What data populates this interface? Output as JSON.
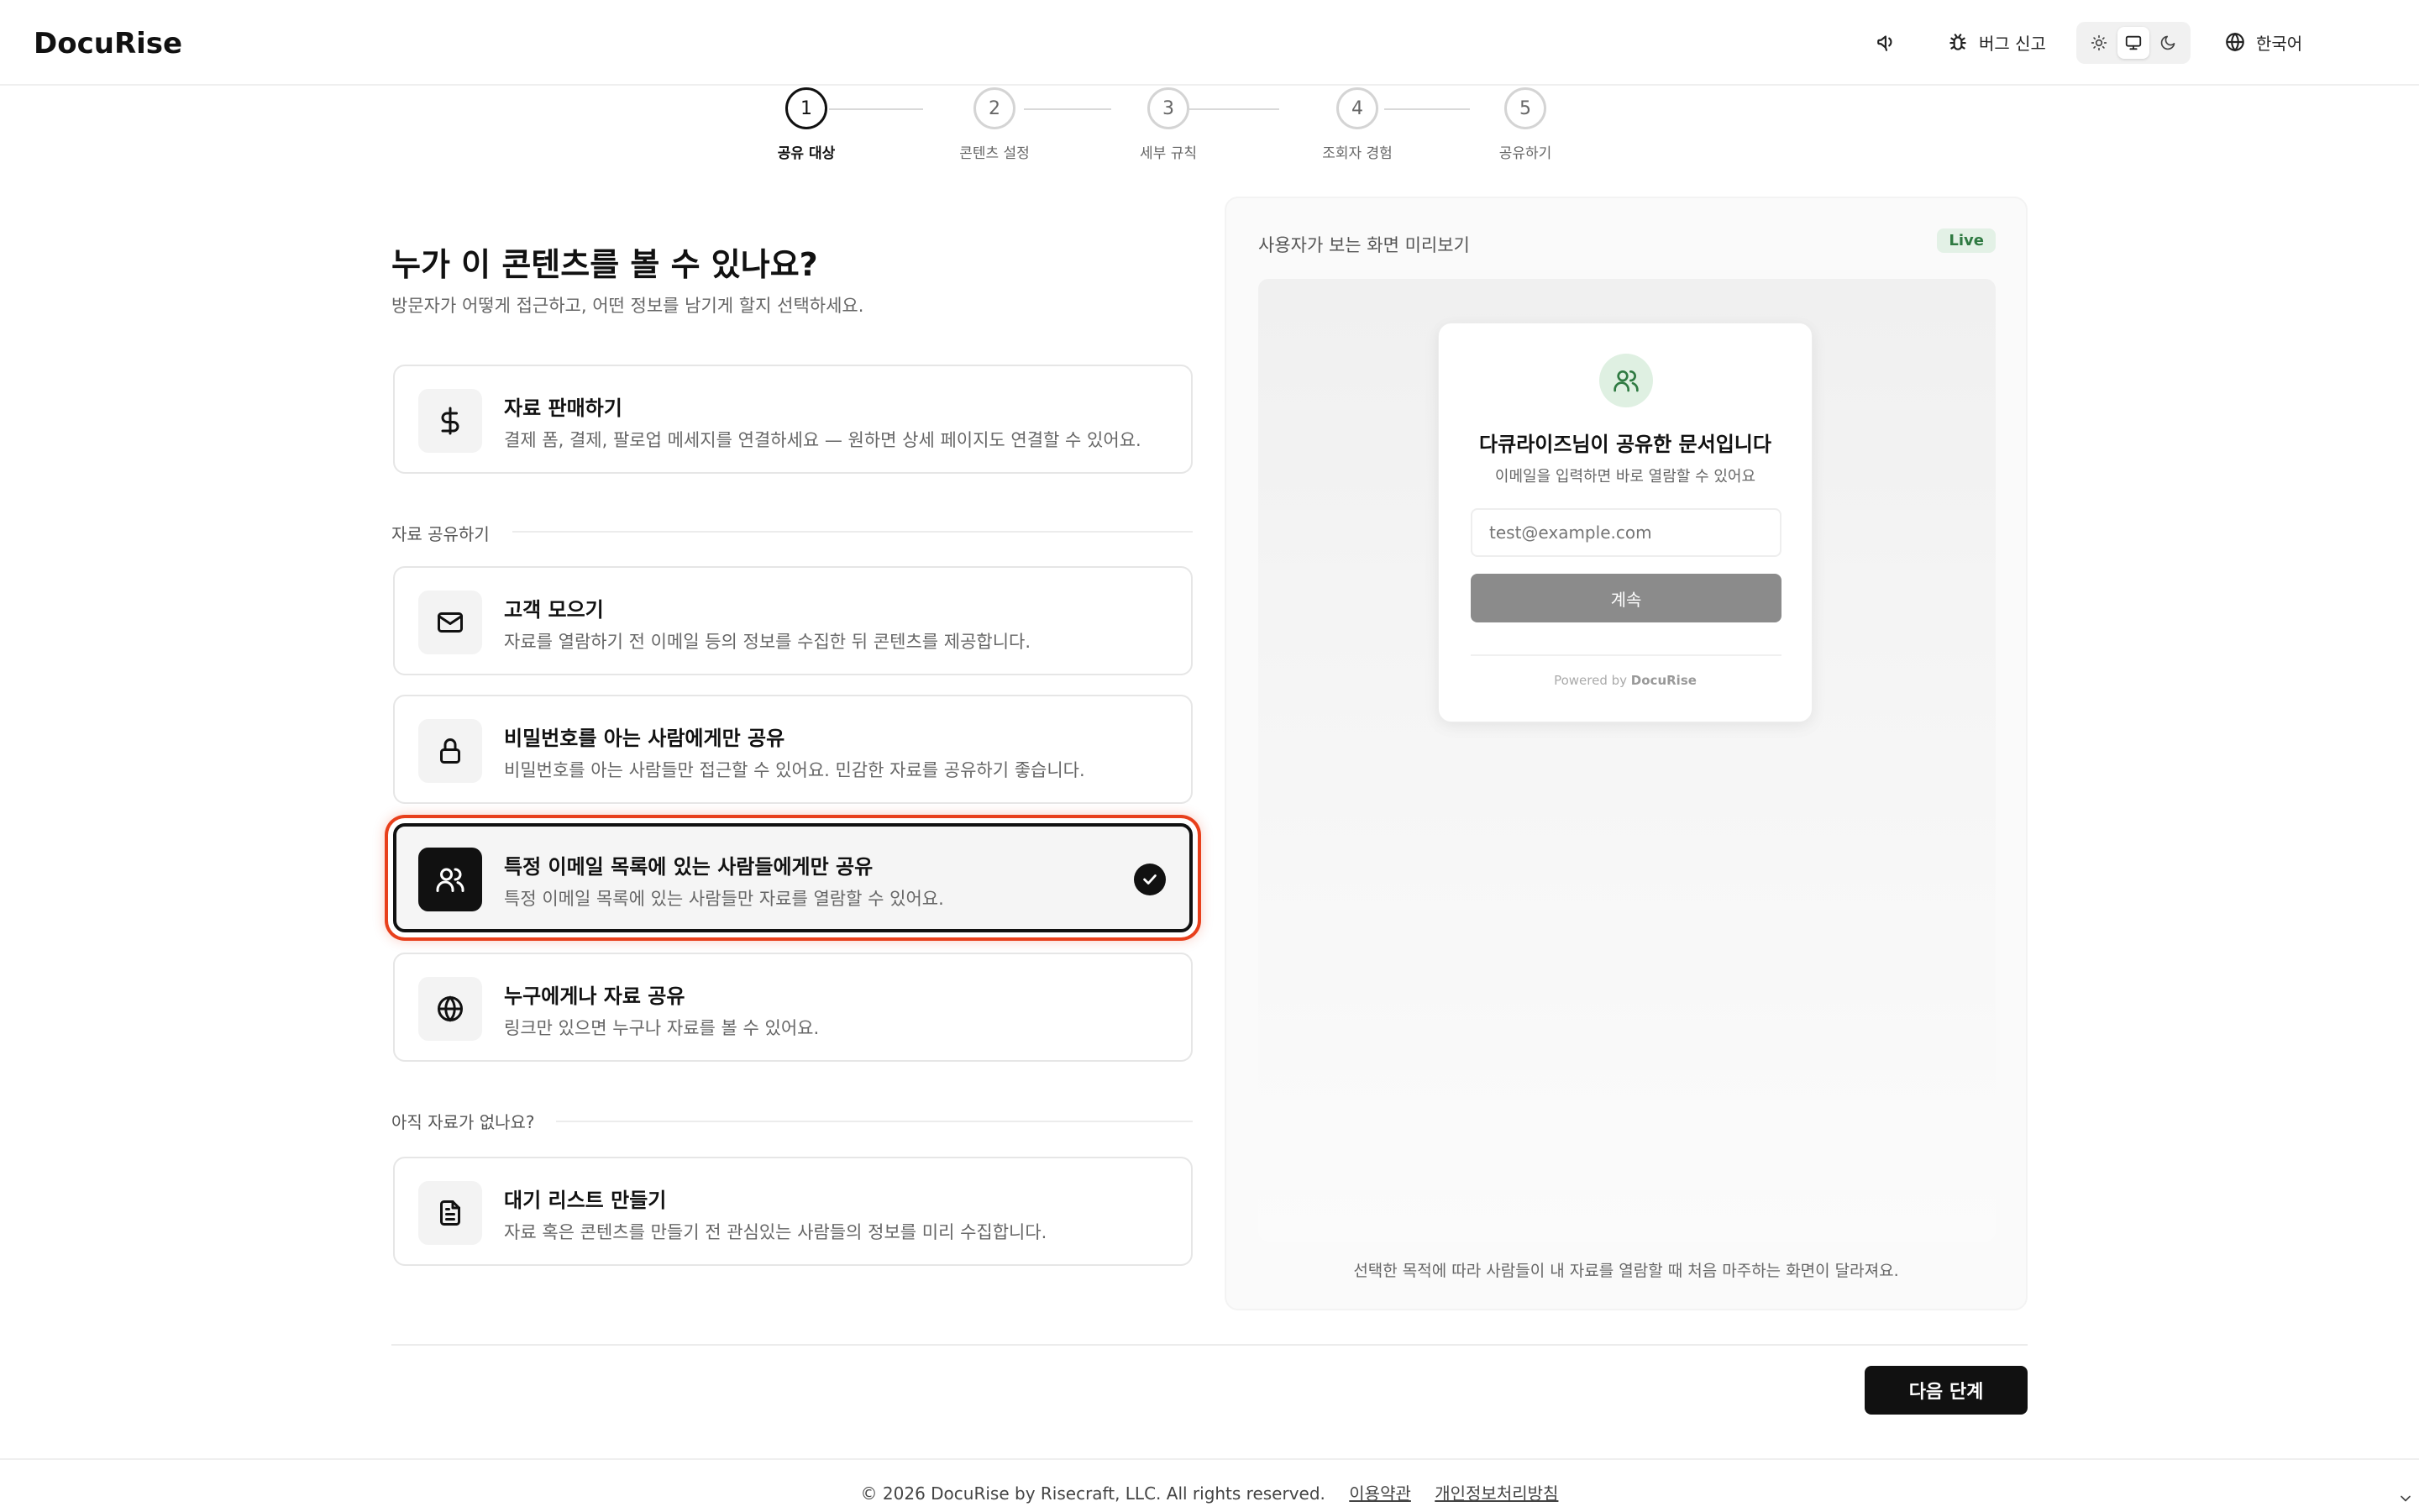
{
  "header": {
    "logo": "DocuRise",
    "bug_report": "버그 신고",
    "language": "한국어",
    "theme_options": [
      "sun-icon",
      "monitor-icon",
      "moon-icon"
    ],
    "theme_selected": "monitor-icon"
  },
  "stepper": {
    "current": 1,
    "steps": [
      {
        "num": "1",
        "label": "공유 대상"
      },
      {
        "num": "2",
        "label": "콘텐츠 설정"
      },
      {
        "num": "3",
        "label": "세부 규칙"
      },
      {
        "num": "4",
        "label": "조회자 경험"
      },
      {
        "num": "5",
        "label": "공유하기"
      }
    ]
  },
  "main": {
    "title": "누가 이 콘텐츠를 볼 수 있나요?",
    "subtitle": "방문자가 어떻게 접근하고, 어떤 정보를 남기게 할지 선택하세요.",
    "sell": {
      "icon": "dollar-icon",
      "title": "자료 판매하기",
      "desc": "결제 폼, 결제, 팔로업 메세지를 연결하세요 — 원하면 상세 페이지도 연결할 수 있어요."
    },
    "share_section_label": "자료 공유하기",
    "share_options": [
      {
        "icon": "mail-icon",
        "title": "고객 모으기",
        "desc": "자료를 열람하기 전 이메일 등의 정보를 수집한 뒤 콘텐츠를 제공합니다.",
        "selected": false
      },
      {
        "icon": "lock-icon",
        "title": "비밀번호를 아는 사람에게만 공유",
        "desc": "비밀번호를 아는 사람들만 접근할 수 있어요. 민감한 자료를 공유하기 좋습니다.",
        "selected": false
      },
      {
        "icon": "users-icon",
        "title": "특정 이메일 목록에 있는 사람들에게만 공유",
        "desc": "특정 이메일 목록에 있는 사람들만 자료를 열람할 수 있어요.",
        "selected": true
      },
      {
        "icon": "globe-icon",
        "title": "누구에게나 자료 공유",
        "desc": "링크만 있으면 누구나 자료를 볼 수 있어요.",
        "selected": false
      }
    ],
    "waitlist_section_label": "아직 자료가 없나요?",
    "waitlist": {
      "icon": "document-icon",
      "title": "대기 리스트 만들기",
      "desc": "자료 혹은 콘텐츠를 만들기 전 관심있는 사람들의 정보를 미리 수집합니다."
    }
  },
  "preview": {
    "title": "사용자가 보는 화면 미리보기",
    "badge": "Live",
    "card": {
      "title": "다큐라이즈님이 공유한 문서입니다",
      "subtitle": "이메일을 입력하면 바로 열람할 수 있어요",
      "email_placeholder": "test@example.com",
      "button": "계속",
      "powered_prefix": "Powered by",
      "powered_brand": "DocuRise"
    },
    "caption": "선택한 목적에 따라 사람들이 내 자료를 열람할 때 처음 마주하는 화면이 달라져요."
  },
  "actions": {
    "next": "다음 단계"
  },
  "footer": {
    "copyright": "© 2026 DocuRise by Risecraft, LLC. All rights reserved.",
    "terms": "이용약관",
    "privacy": "개인정보처리방침"
  },
  "colors": {
    "accent": "#111111",
    "highlight_ring": "#e8401c",
    "live_badge_bg": "#e3f1e6",
    "live_badge_text": "#2f7a42"
  }
}
